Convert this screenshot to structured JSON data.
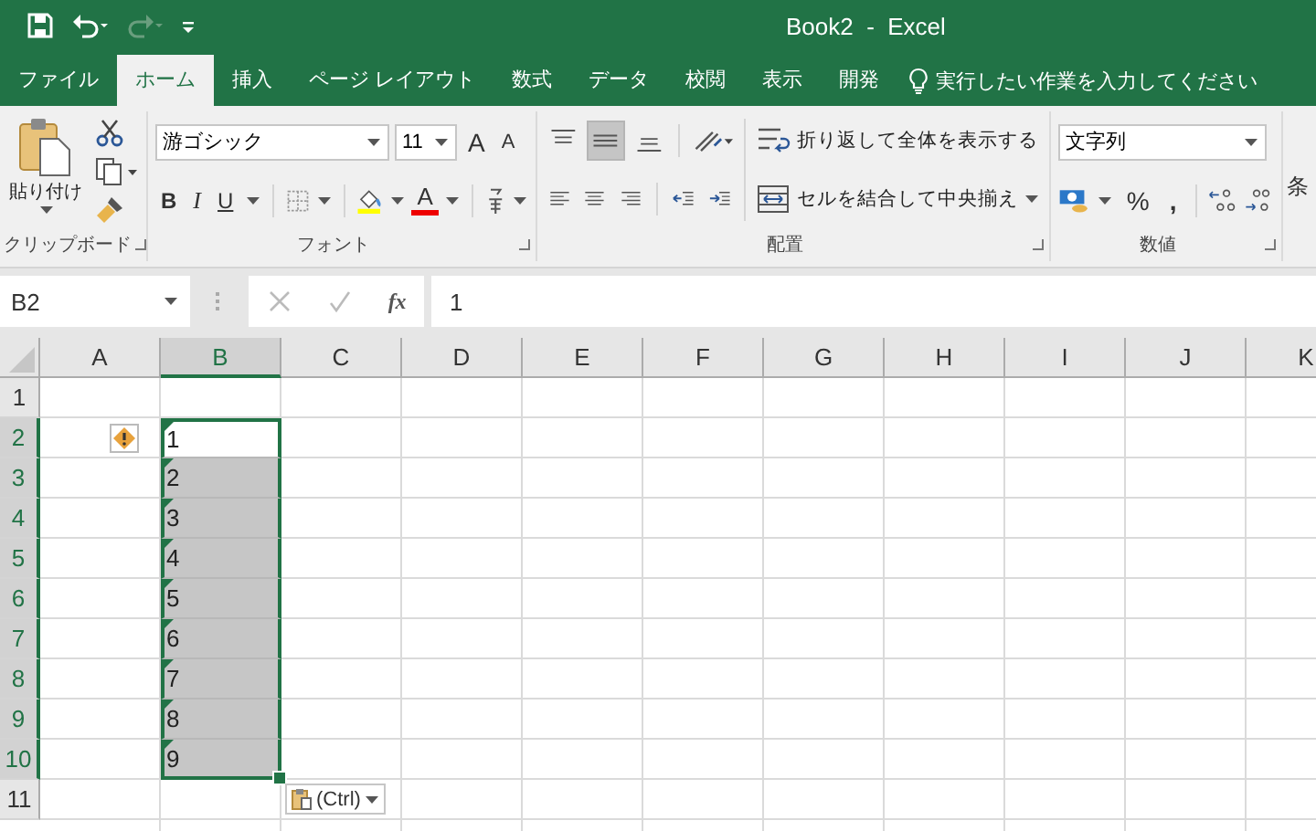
{
  "window": {
    "title": "Book2  -  Excel"
  },
  "tabs": [
    {
      "label": "ファイル",
      "selected": false
    },
    {
      "label": "ホーム",
      "selected": true
    },
    {
      "label": "挿入",
      "selected": false
    },
    {
      "label": "ページ レイアウト",
      "selected": false
    },
    {
      "label": "数式",
      "selected": false
    },
    {
      "label": "データ",
      "selected": false
    },
    {
      "label": "校閲",
      "selected": false
    },
    {
      "label": "表示",
      "selected": false
    },
    {
      "label": "開発",
      "selected": false
    }
  ],
  "tell_me": {
    "placeholder": "実行したい作業を入力してください"
  },
  "ribbon": {
    "clipboard": {
      "label": "クリップボード",
      "paste": "貼り付け"
    },
    "font": {
      "label": "フォント",
      "font_name": "游ゴシック",
      "font_size": "11",
      "grow": "A",
      "shrink": "A",
      "bold": "B",
      "italic": "I",
      "underline": "U",
      "font_color": "A"
    },
    "alignment": {
      "label": "配置",
      "wrap_text": "折り返して全体を表示する",
      "merge_center": "セルを結合して中央揃え",
      "middle_align_selected": true
    },
    "number": {
      "label": "数値",
      "format": "文字列",
      "percent": "%",
      "comma": ","
    },
    "styles": {
      "label_cut": "条"
    }
  },
  "formula_bar": {
    "name_box": "B2",
    "fx": "fx",
    "value": "1"
  },
  "sheet": {
    "columns": [
      {
        "label": "A",
        "selected": false
      },
      {
        "label": "B",
        "selected": true
      },
      {
        "label": "C",
        "selected": false
      },
      {
        "label": "D",
        "selected": false
      },
      {
        "label": "E",
        "selected": false
      },
      {
        "label": "F",
        "selected": false
      },
      {
        "label": "G",
        "selected": false
      },
      {
        "label": "H",
        "selected": false
      },
      {
        "label": "I",
        "selected": false
      },
      {
        "label": "J",
        "selected": false
      },
      {
        "label": "K",
        "selected": false
      }
    ],
    "rows": [
      {
        "label": "1",
        "selected": false
      },
      {
        "label": "2",
        "selected": true,
        "a": {
          "warning": true
        },
        "b": {
          "value": "1",
          "flag": true,
          "active": true
        }
      },
      {
        "label": "3",
        "selected": true,
        "b": {
          "value": "2",
          "flag": true,
          "active": false
        }
      },
      {
        "label": "4",
        "selected": true,
        "b": {
          "value": "3",
          "flag": true,
          "active": false
        }
      },
      {
        "label": "5",
        "selected": true,
        "b": {
          "value": "4",
          "flag": true,
          "active": false
        }
      },
      {
        "label": "6",
        "selected": true,
        "b": {
          "value": "5",
          "flag": true,
          "active": false
        }
      },
      {
        "label": "7",
        "selected": true,
        "b": {
          "value": "6",
          "flag": true,
          "active": false
        }
      },
      {
        "label": "8",
        "selected": true,
        "b": {
          "value": "7",
          "flag": true,
          "active": false
        }
      },
      {
        "label": "9",
        "selected": true,
        "b": {
          "value": "8",
          "flag": true,
          "active": false
        }
      },
      {
        "label": "10",
        "selected": true,
        "b": {
          "value": "9",
          "flag": true,
          "active": false
        }
      },
      {
        "label": "11",
        "selected": false
      }
    ],
    "paste_options": {
      "label": "(Ctrl)"
    }
  }
}
